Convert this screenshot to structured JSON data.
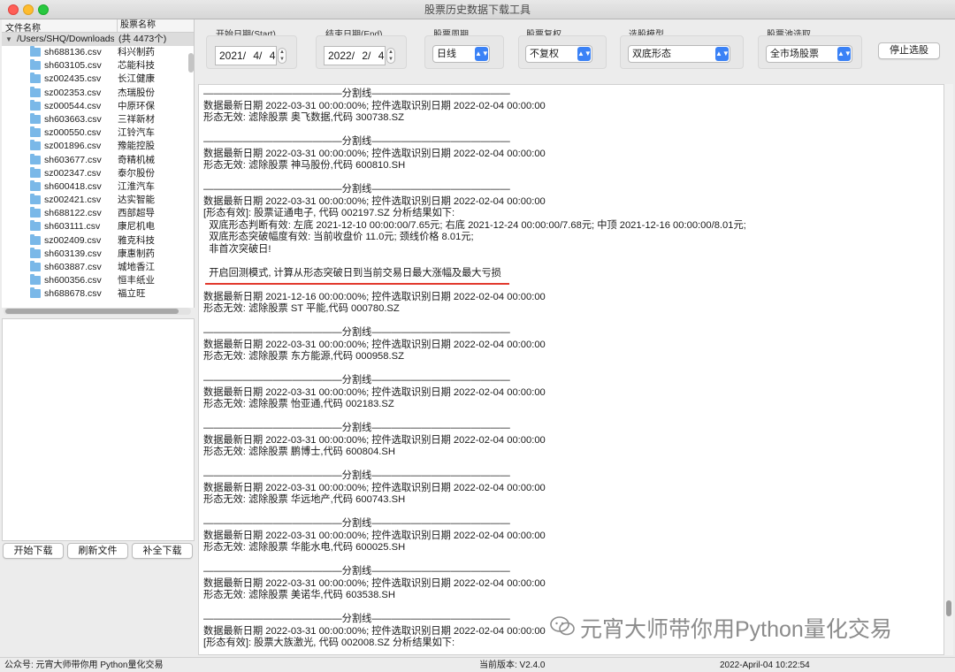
{
  "window": {
    "title": "股票历史数据下载工具"
  },
  "file_tree": {
    "col_file": "文件名称",
    "col_stock": "股票名称",
    "root_path": "/Users/SHQ/Downloads/f",
    "root_count": "(共 4473个)",
    "rows": [
      {
        "file": "sh688136.csv",
        "name": "科兴制药"
      },
      {
        "file": "sh603105.csv",
        "name": "芯能科技"
      },
      {
        "file": "sz002435.csv",
        "name": "长江健康"
      },
      {
        "file": "sz002353.csv",
        "name": "杰瑞股份"
      },
      {
        "file": "sz000544.csv",
        "name": "中原环保"
      },
      {
        "file": "sh603663.csv",
        "name": "三祥新材"
      },
      {
        "file": "sz000550.csv",
        "name": "江铃汽车"
      },
      {
        "file": "sz001896.csv",
        "name": "豫能控股"
      },
      {
        "file": "sh603677.csv",
        "name": "奇精机械"
      },
      {
        "file": "sz002347.csv",
        "name": "泰尔股份"
      },
      {
        "file": "sh600418.csv",
        "name": "江淮汽车"
      },
      {
        "file": "sz002421.csv",
        "name": "达实智能"
      },
      {
        "file": "sh688122.csv",
        "name": "西部超导"
      },
      {
        "file": "sh603111.csv",
        "name": "康尼机电"
      },
      {
        "file": "sz002409.csv",
        "name": "雅克科技"
      },
      {
        "file": "sh603139.csv",
        "name": "康惠制药"
      },
      {
        "file": "sh603887.csv",
        "name": "城地香江"
      },
      {
        "file": "sh600356.csv",
        "name": "恒丰纸业"
      },
      {
        "file": "sh688678.csv",
        "name": "福立旺"
      }
    ]
  },
  "buttons": {
    "start_download": "开始下载",
    "refresh_files": "刷新文件",
    "complete_download": "补全下载",
    "stop_select": "停止选股"
  },
  "controls": {
    "start_label": "开始日期(Start)",
    "start_y": "2021/",
    "start_m": "4/",
    "start_d": "4",
    "end_label": "结束日期(End)",
    "end_y": "2022/",
    "end_m": "2/",
    "end_d": "4",
    "period_label": "股票周期",
    "period_value": "日线",
    "adjust_label": "股票复权",
    "adjust_value": "不复权",
    "model_label": "选股模型",
    "model_value": "双底形态",
    "pool_label": "股票池选取",
    "pool_value": "全市场股票"
  },
  "log": [
    {
      "sep": "——————————————分割线——————————————",
      "lines": [
        "数据最新日期 2022-03-31 00:00:00%; 控件选取识别日期 2022-02-04 00:00:00",
        "形态无效: 滤除股票 奥飞数据,代码 300738.SZ"
      ]
    },
    {
      "sep": "——————————————分割线——————————————",
      "lines": [
        "数据最新日期 2022-03-31 00:00:00%; 控件选取识别日期 2022-02-04 00:00:00",
        "形态无效: 滤除股票 神马股份,代码 600810.SH"
      ]
    },
    {
      "sep": "——————————————分割线——————————————",
      "lines": [
        "数据最新日期 2022-03-31 00:00:00%; 控件选取识别日期 2022-02-04 00:00:00",
        "[形态有效]: 股票证通电子, 代码 002197.SZ 分析结果如下:",
        "  双底形态判断有效: 左底 2021-12-10 00:00:00/7.65元; 右底 2021-12-24 00:00:00/7.68元; 中顶 2021-12-16 00:00:00/8.01元;",
        "  双底形态突破幅度有效: 当前收盘价 11.0元; 颈线价格 8.01元;",
        "  非首次突破日!",
        "",
        "  开启回测模式, 计算从形态突破日到当前交易日最大涨幅及最大亏损",
        "",
        "数据最新日期 2021-12-16 00:00:00%; 控件选取识别日期 2022-02-04 00:00:00",
        "形态无效: 滤除股票 ST 平能,代码 000780.SZ"
      ]
    },
    {
      "sep": "——————————————分割线——————————————",
      "lines": [
        "数据最新日期 2022-03-31 00:00:00%; 控件选取识别日期 2022-02-04 00:00:00",
        "形态无效: 滤除股票 东方能源,代码 000958.SZ"
      ]
    },
    {
      "sep": "——————————————分割线——————————————",
      "lines": [
        "数据最新日期 2022-03-31 00:00:00%; 控件选取识别日期 2022-02-04 00:00:00",
        "形态无效: 滤除股票 怡亚通,代码 002183.SZ"
      ]
    },
    {
      "sep": "——————————————分割线——————————————",
      "lines": [
        "数据最新日期 2022-03-31 00:00:00%; 控件选取识别日期 2022-02-04 00:00:00",
        "形态无效: 滤除股票 鹏博士,代码 600804.SH"
      ]
    },
    {
      "sep": "——————————————分割线——————————————",
      "lines": [
        "数据最新日期 2022-03-31 00:00:00%; 控件选取识别日期 2022-02-04 00:00:00",
        "形态无效: 滤除股票 华远地产,代码 600743.SH"
      ]
    },
    {
      "sep": "——————————————分割线——————————————",
      "lines": [
        "数据最新日期 2022-03-31 00:00:00%; 控件选取识别日期 2022-02-04 00:00:00",
        "形态无效: 滤除股票 华能水电,代码 600025.SH"
      ]
    },
    {
      "sep": "——————————————分割线——————————————",
      "lines": [
        "数据最新日期 2022-03-31 00:00:00%; 控件选取识别日期 2022-02-04 00:00:00",
        "形态无效: 滤除股票 美诺华,代码 603538.SH"
      ]
    },
    {
      "sep": "——————————————分割线——————————————",
      "lines": [
        "数据最新日期 2022-03-31 00:00:00%; 控件选取识别日期 2022-02-04 00:00:00",
        "[形态有效]: 股票大族激光, 代码 002008.SZ 分析结果如下:"
      ]
    }
  ],
  "watermark": "元宵大师带你用Python量化交易",
  "status": {
    "left": "公众号: 元宵大师带你用 Python量化交易",
    "version": "当前版本: V2.4.0",
    "datetime": "2022-April-04 10:22:54"
  },
  "colors": {
    "accent": "#3b82f6",
    "underline": "#e23a2e"
  }
}
